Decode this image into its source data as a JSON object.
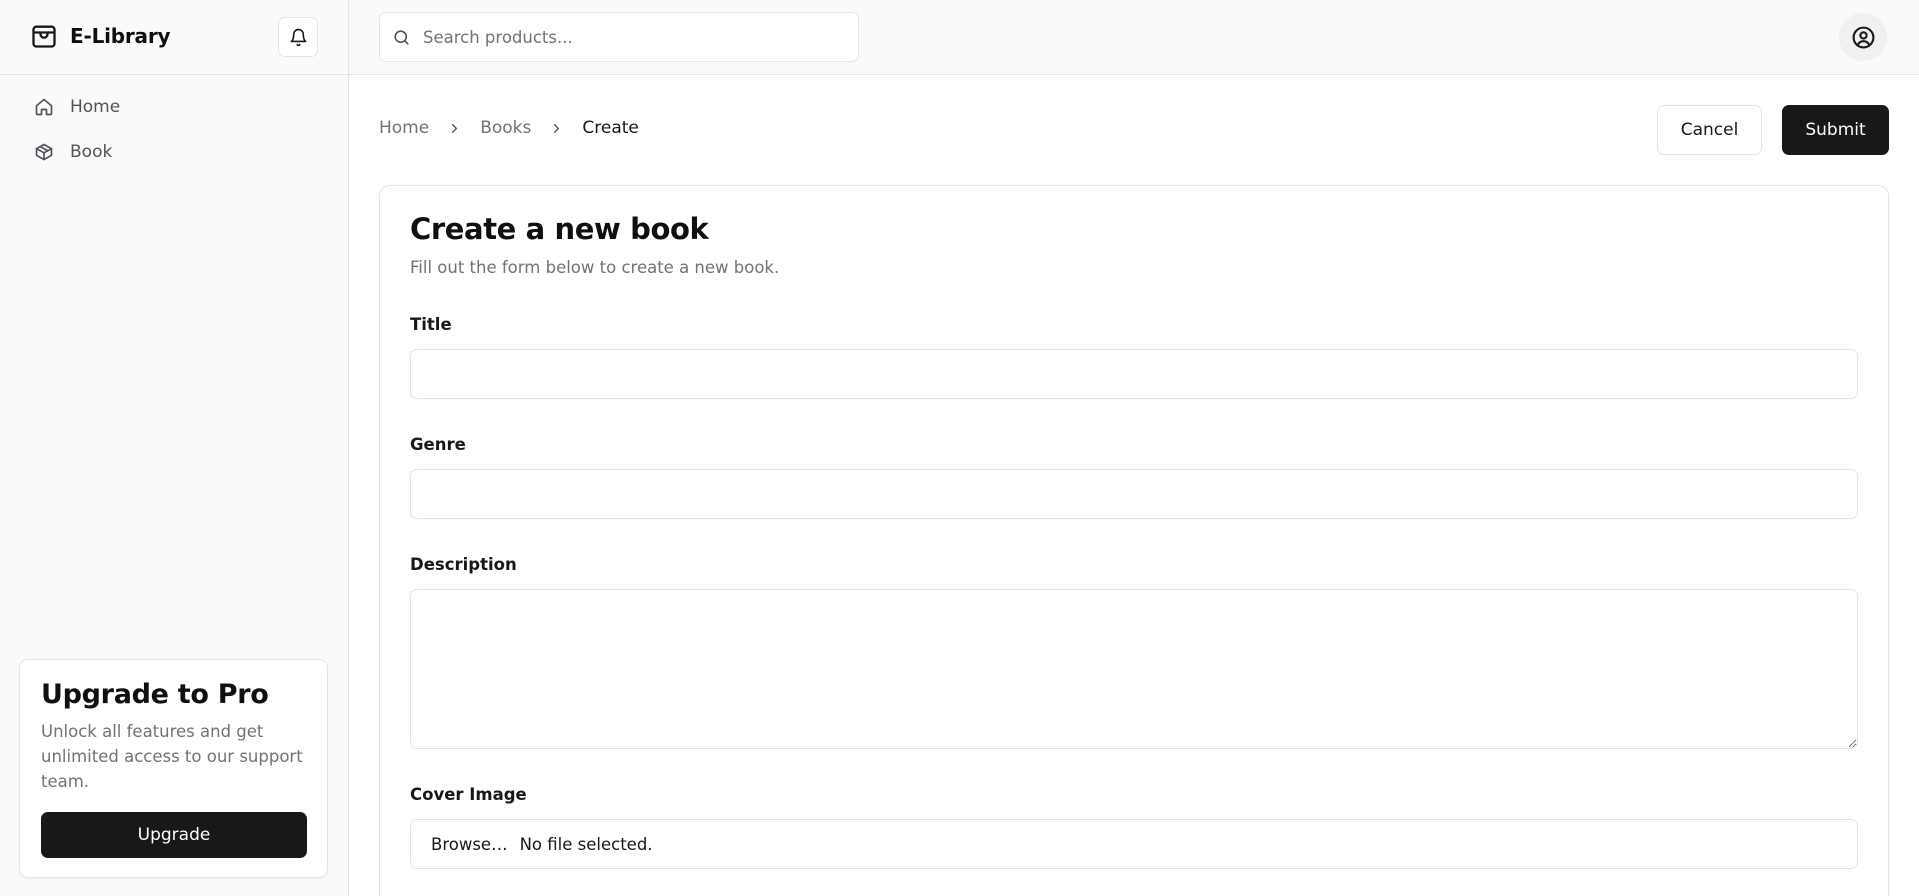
{
  "app": {
    "name": "E-Library"
  },
  "sidebar": {
    "nav": [
      {
        "label": "Home",
        "icon": "home-icon"
      },
      {
        "label": "Book",
        "icon": "package-icon"
      }
    ],
    "upgrade": {
      "title": "Upgrade to Pro",
      "description": "Unlock all features and get unlimited access to our support team.",
      "button_label": "Upgrade"
    }
  },
  "topbar": {
    "search": {
      "placeholder": "Search products...",
      "value": ""
    },
    "user_icon": "user-circle-icon",
    "notifications_icon": "bell-icon"
  },
  "breadcrumb": [
    {
      "label": "Home"
    },
    {
      "label": "Books"
    },
    {
      "label": "Create"
    }
  ],
  "actions": {
    "cancel_label": "Cancel",
    "submit_label": "Submit"
  },
  "form": {
    "title": "Create a new book",
    "subtitle": "Fill out the form below to create a new book.",
    "fields": {
      "title": {
        "label": "Title",
        "value": ""
      },
      "genre": {
        "label": "Genre",
        "value": ""
      },
      "description": {
        "label": "Description",
        "value": ""
      },
      "cover_image": {
        "label": "Cover Image",
        "browse_label": "Browse…",
        "status": "No file selected."
      }
    }
  },
  "colors": {
    "primary": "#18181b",
    "muted_text": "#71717a",
    "border": "#e4e4e7",
    "sidebar_bg": "#fafafa"
  }
}
